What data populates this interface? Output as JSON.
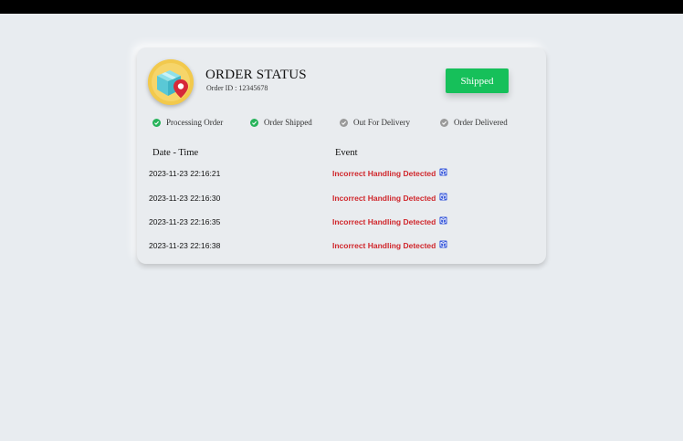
{
  "header": {
    "title": "ORDER STATUS",
    "order_id": "Order ID : 12345678",
    "status_button": "Shipped",
    "accent": "#16c05a"
  },
  "steps": [
    {
      "label": "Processing Order",
      "done": true
    },
    {
      "label": "Order Shipped",
      "done": true
    },
    {
      "label": "Out For Delivery",
      "done": false
    },
    {
      "label": "Order Delivered",
      "done": false
    }
  ],
  "table": {
    "columns": [
      "Date - Time",
      "Event"
    ],
    "rows": [
      {
        "datetime": "2023-11-23 22:16:21",
        "event": "Incorrect Handling Detected"
      },
      {
        "datetime": "2023-11-23 22:16:30",
        "event": "Incorrect Handling Detected"
      },
      {
        "datetime": "2023-11-23 22:16:35",
        "event": "Incorrect Handling Detected"
      },
      {
        "datetime": "2023-11-23 22:16:38",
        "event": "Incorrect Handling Detected"
      }
    ]
  },
  "colors": {
    "done": "#27b35a",
    "pending": "#9a9a9a",
    "event_text": "#d0262b",
    "event_icon": "#3b5bdb"
  },
  "icons": {
    "avatar": "package-location-icon",
    "step_check": "check-circle-icon",
    "event": "package-alert-icon"
  }
}
